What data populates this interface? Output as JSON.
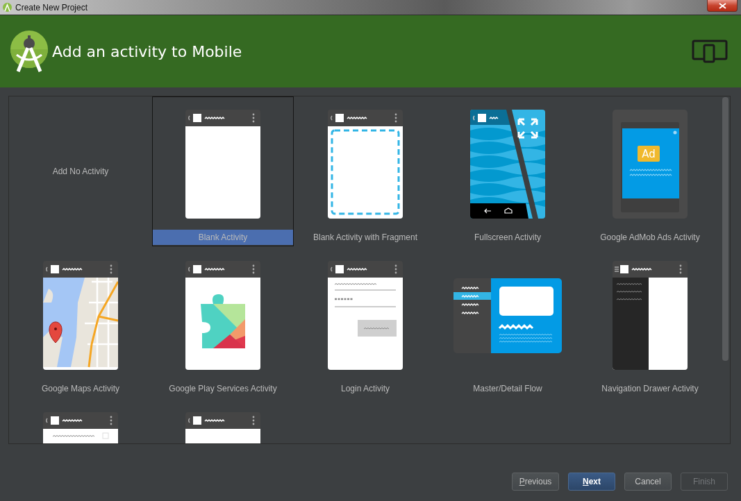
{
  "window": {
    "title": "Create New Project"
  },
  "header": {
    "title": "Add an activity to Mobile"
  },
  "templates": [
    {
      "kind": "none",
      "label": "Add No Activity",
      "selected": false
    },
    {
      "kind": "blank",
      "label": "Blank Activity",
      "selected": true
    },
    {
      "kind": "fragment",
      "label": "Blank Activity with Fragment",
      "selected": false
    },
    {
      "kind": "fullscreen",
      "label": "Fullscreen Activity",
      "selected": false
    },
    {
      "kind": "admob",
      "label": "Google AdMob Ads Activity",
      "selected": false,
      "badge": "Ad"
    },
    {
      "kind": "maps",
      "label": "Google Maps Activity",
      "selected": false
    },
    {
      "kind": "play",
      "label": "Google Play Services Activity",
      "selected": false
    },
    {
      "kind": "login",
      "label": "Login Activity",
      "selected": false
    },
    {
      "kind": "master_detail",
      "label": "Master/Detail Flow",
      "selected": false
    },
    {
      "kind": "nav_drawer",
      "label": "Navigation Drawer Activity",
      "selected": false
    },
    {
      "kind": "settings",
      "selected": false
    },
    {
      "kind": "tabbed",
      "selected": false
    }
  ],
  "buttons": [
    {
      "label": "Previous",
      "mnemonic": true,
      "default": false,
      "disabled": false
    },
    {
      "label": "Next",
      "mnemonic": true,
      "default": true,
      "disabled": false
    },
    {
      "label": "Cancel",
      "mnemonic": false,
      "default": false,
      "disabled": false
    },
    {
      "label": "Finish",
      "mnemonic": false,
      "default": false,
      "disabled": true
    }
  ]
}
